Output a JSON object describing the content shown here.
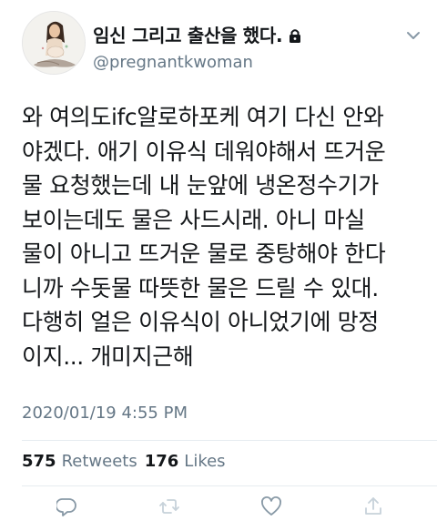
{
  "header": {
    "display_name": "임신 그리고 출산을 했다.",
    "handle": "@pregnantkwoman",
    "avatar_icon": "pregnant-woman-avatar",
    "lock_icon": "lock-icon",
    "menu_icon": "chevron-down-icon"
  },
  "tweet": {
    "lines": [
      "와 여의도ifc알로하포케 여기 다신 안와",
      "야겠다. 애기 이유식 데워야해서 뜨거운",
      "물 요청했는데 내 눈앞에 냉온정수기가",
      "보이는데도 물은 사드시래. 아니 마실",
      "물이 아니고 뜨거운 물로 중탕해야 한다",
      "니까 수돗물 따뜻한 물은 드릴 수 있대.",
      "다행히 얼은 이유식이 아니었기에 망정",
      "이지... 개미지근해"
    ],
    "timestamp": "2020/01/19 4:55 PM"
  },
  "stats": {
    "retweets_count": "575",
    "retweets_label": "Retweets",
    "likes_count": "176",
    "likes_label": "Likes"
  },
  "actions": {
    "reply_icon": "reply-icon",
    "retweet_icon": "retweet-icon",
    "like_icon": "heart-icon",
    "share_icon": "share-icon"
  },
  "colors": {
    "text": "#14171a",
    "secondary": "#657786",
    "divider": "#e6ecf0",
    "action_icon": "#8899a6"
  }
}
